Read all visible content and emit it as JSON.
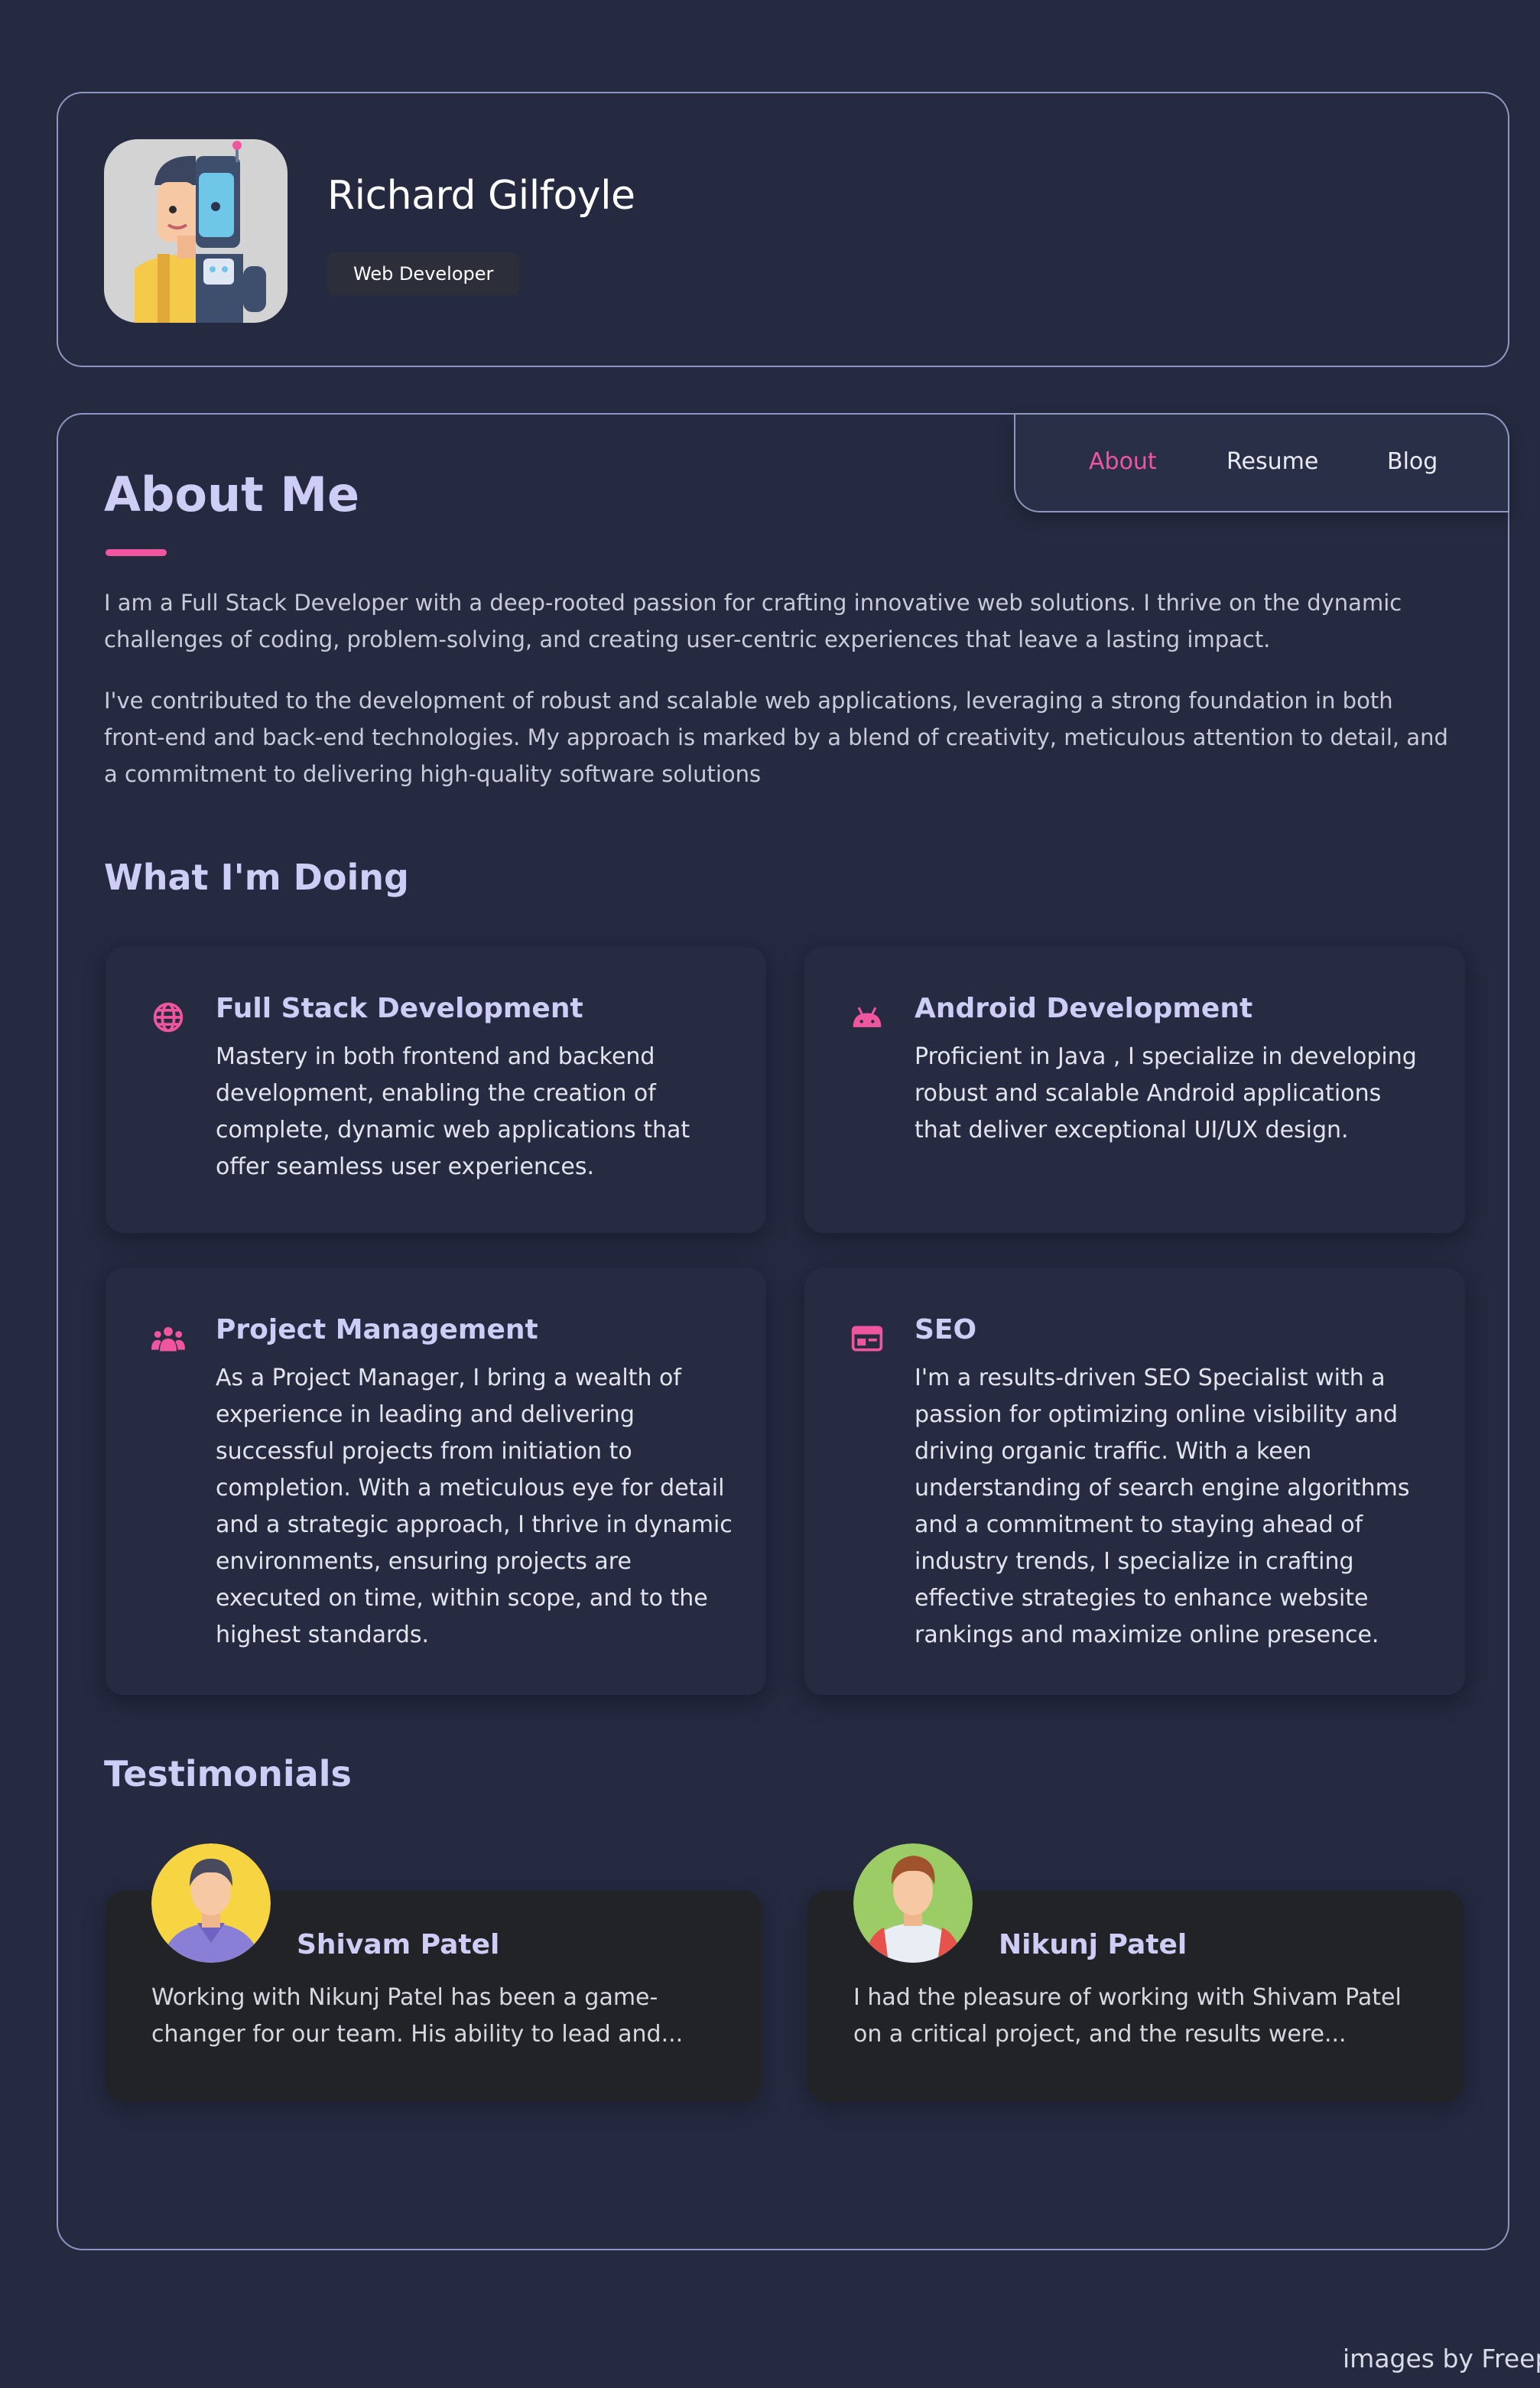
{
  "profile": {
    "name": "Richard Gilfoyle",
    "role": "Web Developer"
  },
  "tabs": [
    {
      "label": "About",
      "active": true
    },
    {
      "label": "Resume",
      "active": false
    },
    {
      "label": "Blog",
      "active": false
    }
  ],
  "about": {
    "title": "About Me",
    "paragraphs": [
      "I am a Full Stack Developer with a deep-rooted passion for crafting innovative web solutions. I thrive on the dynamic challenges of coding, problem-solving, and creating user-centric experiences that leave a lasting impact.",
      "I've contributed to the development of robust and scalable web applications, leveraging a strong foundation in both front-end and back-end technologies. My approach is marked by a blend of creativity, meticulous attention to detail, and a commitment to delivering high-quality software solutions"
    ]
  },
  "doing": {
    "title": "What I'm Doing",
    "services": [
      {
        "icon": "globe-icon",
        "title": "Full Stack Development",
        "text": "Mastery in both frontend and backend development, enabling the creation of complete, dynamic web applications that offer seamless user experiences."
      },
      {
        "icon": "android-icon",
        "title": "Android Development",
        "text": "Proficient in Java , I specialize in developing robust and scalable Android applications that deliver exceptional UI/UX design."
      },
      {
        "icon": "team-icon",
        "title": "Project Management",
        "text": "As a Project Manager, I bring a wealth of experience in leading and delivering successful projects from initiation to completion. With a meticulous eye for detail and a strategic approach, I thrive in dynamic environments, ensuring projects are executed on time, within scope, and to the highest standards."
      },
      {
        "icon": "browser-window-icon",
        "title": "SEO",
        "text": "I'm a results-driven SEO Specialist with a passion for optimizing online visibility and driving organic traffic. With a keen understanding of search engine algorithms and a commitment to staying ahead of industry trends, I specialize in crafting effective strategies to enhance website rankings and maximize online presence."
      }
    ]
  },
  "testimonials": {
    "title": "Testimonials",
    "items": [
      {
        "name": "Shivam Patel",
        "text": "Working with Nikunj Patel has been a game-changer for our team. His ability to lead and..."
      },
      {
        "name": "Nikunj Patel",
        "text": "I had the pleasure of working with Shivam Patel on a critical project, and the results were..."
      }
    ]
  },
  "footer": {
    "credit": "images by Freepik"
  },
  "colors": {
    "accent": "#f0569f",
    "heading": "#cdcdf6",
    "background": "#252a40",
    "border": "#8f96bf"
  }
}
